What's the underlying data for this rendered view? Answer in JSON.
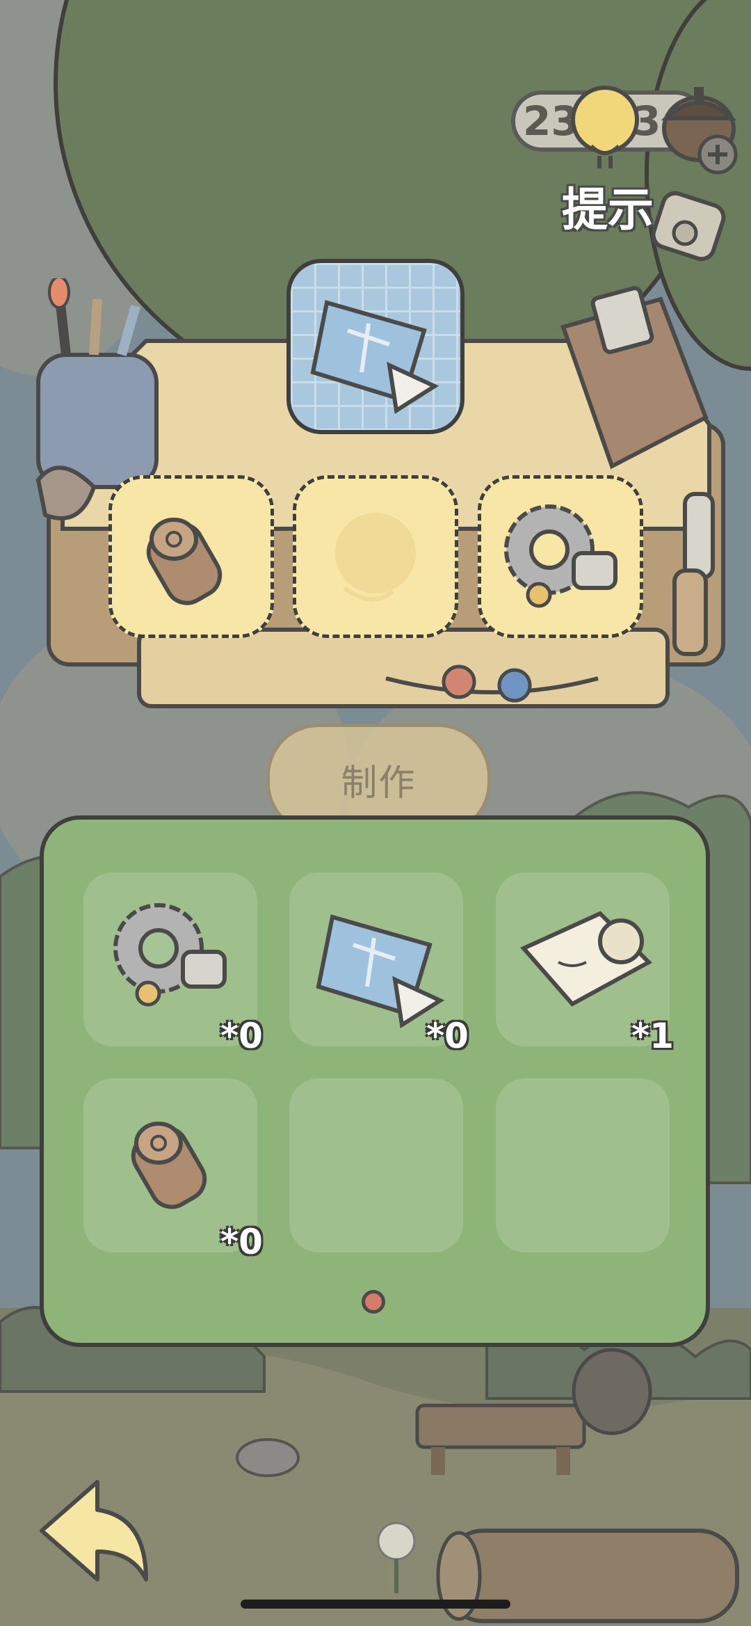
{
  "hud": {
    "leaf_count": "23",
    "acorn_count": "3",
    "hint_label": "提示"
  },
  "craft": {
    "target_item": "blueprint-icon",
    "recipe_slots": [
      "wood-log-icon",
      "yarn-ball-icon",
      "gear-icon"
    ],
    "button_label": "制作"
  },
  "inventory": {
    "items": [
      {
        "icon": "gear-icon",
        "count": "*0"
      },
      {
        "icon": "blueprint-icon",
        "count": "*0"
      },
      {
        "icon": "paper-scroll-icon",
        "count": "*1"
      },
      {
        "icon": "wood-log-icon",
        "count": "*0"
      }
    ]
  },
  "colors": {
    "panel_green": "#8fb47a",
    "table_wood": "#ead7a8",
    "slot_highlight": "#f7e6a6",
    "outline": "#3f3f3c",
    "canopy_green": "#6b7d5c"
  }
}
